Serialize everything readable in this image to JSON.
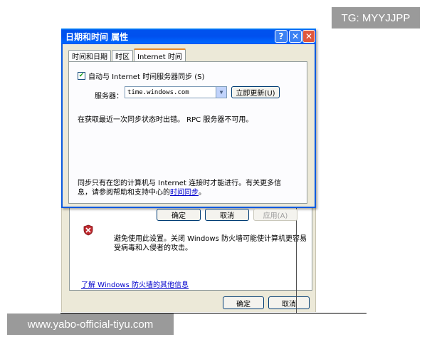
{
  "watermarks": {
    "top_right": "TG: MYYJJPP",
    "bottom_left": "www.yabo-official-tiyu.com"
  },
  "dialog": {
    "title": "日期和时间 属性",
    "help_btn": "?",
    "close_btn": "✕",
    "tabs": [
      "时间和日期",
      "时区",
      "Internet 时间"
    ],
    "active_tab": 2,
    "sync_checkbox_label": "自动与 Internet 时间服务器同步 (S)",
    "sync_checked": true,
    "server_label": "服务器：",
    "server_value": "time.windows.com",
    "update_now": "立即更新(U)",
    "status": "在获取最近一次同步状态时出错。 RPC 服务器不可用。",
    "info_text": "同步只有在您的计算机与 Internet 连接时才能进行。有关更多信息，请参阅帮助和支持中心的",
    "info_link": "时间同步",
    "info_end": "。",
    "ok": "确定",
    "cancel": "取消",
    "apply": "应用(A)"
  },
  "background_dialog": {
    "warning_text": "避免使用此设置。关闭 Windows 防火墙可能使计算机更容易受病毒和入侵者的攻击。",
    "link": "了解 Windows 防火墙的其他信息",
    "ok": "确定",
    "cancel": "取消"
  },
  "colors": {
    "titlebar": "#0053ee",
    "dialog_bg": "#ece9d8",
    "tab_accent": "#e68b2c",
    "link": "#0000cc"
  },
  "icons": [
    "help-icon",
    "close-icon",
    "checkmark-icon",
    "dropdown-arrow-icon",
    "shield-icon"
  ]
}
